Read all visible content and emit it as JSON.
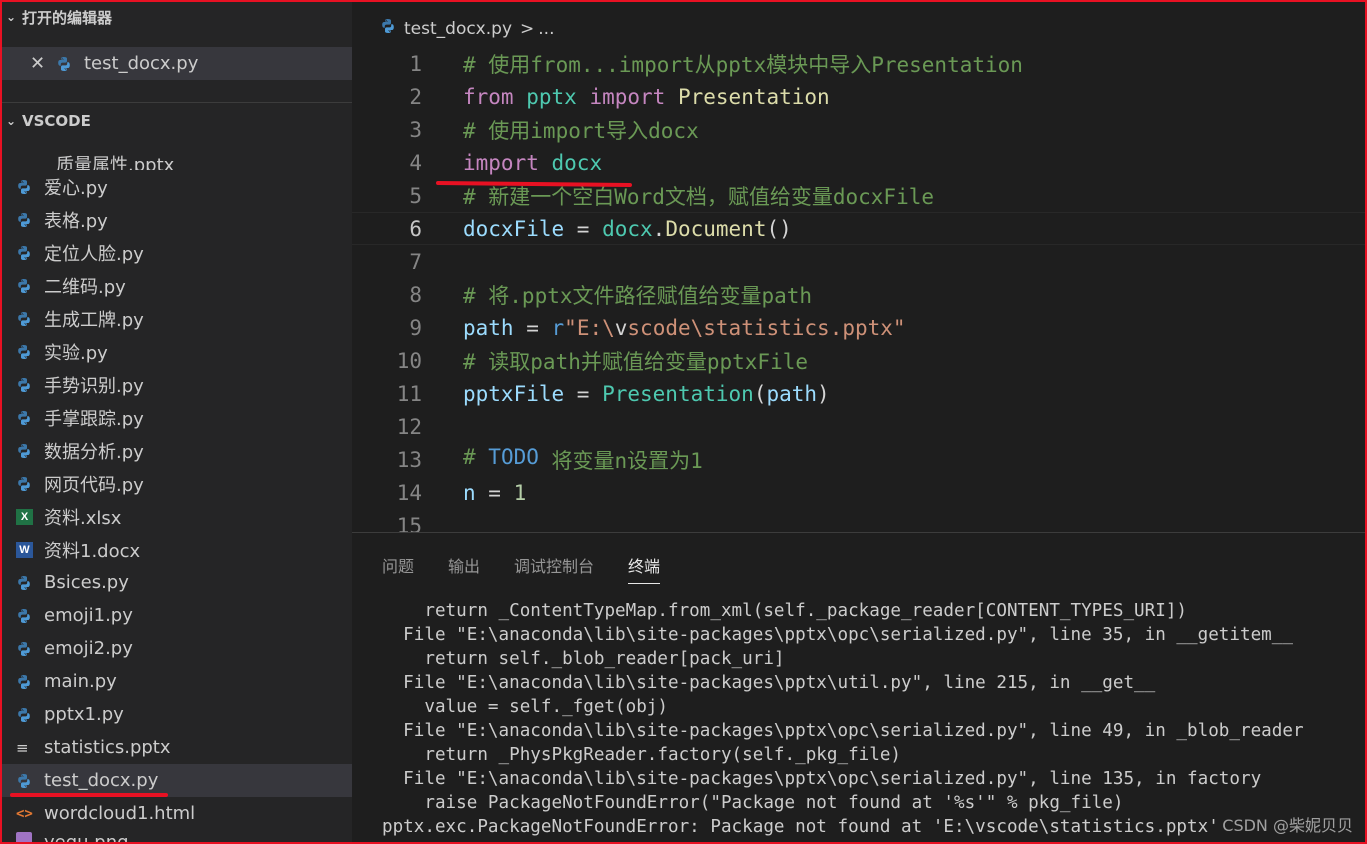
{
  "sidebar": {
    "open_editors_title": "打开的编辑器",
    "open_editors": [
      {
        "label": "test_docx.py"
      }
    ],
    "explorer_title": "VSCODE",
    "files": [
      {
        "label": "质量属性.pptx",
        "icon": "lines-icon"
      },
      {
        "label": "爱心.py",
        "icon": "python-icon"
      },
      {
        "label": "表格.py",
        "icon": "python-icon"
      },
      {
        "label": "定位人脸.py",
        "icon": "python-icon"
      },
      {
        "label": "二维码.py",
        "icon": "python-icon"
      },
      {
        "label": "生成工牌.py",
        "icon": "python-icon"
      },
      {
        "label": "实验.py",
        "icon": "python-icon"
      },
      {
        "label": "手势识别.py",
        "icon": "python-icon"
      },
      {
        "label": "手掌跟踪.py",
        "icon": "python-icon"
      },
      {
        "label": "数据分析.py",
        "icon": "python-icon"
      },
      {
        "label": "网页代码.py",
        "icon": "python-icon"
      },
      {
        "label": "资料.xlsx",
        "icon": "excel-icon"
      },
      {
        "label": "资料1.docx",
        "icon": "word-icon"
      },
      {
        "label": "Bsices.py",
        "icon": "python-icon"
      },
      {
        "label": "emoji1.py",
        "icon": "python-icon"
      },
      {
        "label": "emoji2.py",
        "icon": "python-icon"
      },
      {
        "label": "main.py",
        "icon": "python-icon"
      },
      {
        "label": "pptx1.py",
        "icon": "python-icon"
      },
      {
        "label": "statistics.pptx",
        "icon": "lines-icon"
      },
      {
        "label": "test_docx.py",
        "icon": "python-icon",
        "active": true
      },
      {
        "label": "wordcloud1.html",
        "icon": "html-icon"
      },
      {
        "label": "yegu.png",
        "icon": "image-icon"
      }
    ]
  },
  "editor": {
    "breadcrumb_file": "test_docx.py",
    "breadcrumb_sep": ">",
    "breadcrumb_more": "...",
    "current_line": 6,
    "lines": [
      {
        "n": "1",
        "tokens": [
          {
            "t": "# 使用from...import从pptx模块中导入Presentation",
            "c": "com"
          }
        ]
      },
      {
        "n": "2",
        "tokens": [
          {
            "t": "from",
            "c": "kw"
          },
          {
            "t": " ",
            "c": "op"
          },
          {
            "t": "pptx",
            "c": "mod"
          },
          {
            "t": " ",
            "c": "op"
          },
          {
            "t": "import",
            "c": "kw"
          },
          {
            "t": " ",
            "c": "op"
          },
          {
            "t": "Presentation",
            "c": "fn"
          }
        ]
      },
      {
        "n": "3",
        "tokens": [
          {
            "t": "# 使用import导入docx",
            "c": "com"
          }
        ]
      },
      {
        "n": "4",
        "tokens": [
          {
            "t": "import",
            "c": "kw"
          },
          {
            "t": " ",
            "c": "op"
          },
          {
            "t": "docx",
            "c": "mod"
          }
        ]
      },
      {
        "n": "5",
        "tokens": [
          {
            "t": "# 新建一个空白Word文档，赋值给变量docxFile",
            "c": "com"
          }
        ]
      },
      {
        "n": "6",
        "tokens": [
          {
            "t": "docxFile",
            "c": "var"
          },
          {
            "t": " = ",
            "c": "op"
          },
          {
            "t": "docx",
            "c": "mod"
          },
          {
            "t": ".",
            "c": "op"
          },
          {
            "t": "Document",
            "c": "fn"
          },
          {
            "t": "()",
            "c": "op"
          }
        ]
      },
      {
        "n": "7",
        "tokens": []
      },
      {
        "n": "8",
        "tokens": [
          {
            "t": "# 将.pptx文件路径赋值给变量path",
            "c": "com"
          }
        ]
      },
      {
        "n": "9",
        "tokens": [
          {
            "t": "path",
            "c": "var"
          },
          {
            "t": " = ",
            "c": "op"
          },
          {
            "t": "r",
            "c": "sp"
          },
          {
            "t": "\"E:\\",
            "c": "str"
          },
          {
            "t": "v",
            "c": "op"
          },
          {
            "t": "scode\\statistics.pptx\"",
            "c": "str"
          }
        ]
      },
      {
        "n": "10",
        "tokens": [
          {
            "t": "# 读取path并赋值给变量pptxFile",
            "c": "com"
          }
        ]
      },
      {
        "n": "11",
        "tokens": [
          {
            "t": "pptxFile",
            "c": "var"
          },
          {
            "t": " = ",
            "c": "op"
          },
          {
            "t": "Presentation",
            "c": "cls"
          },
          {
            "t": "(",
            "c": "op"
          },
          {
            "t": "path",
            "c": "var"
          },
          {
            "t": ")",
            "c": "op"
          }
        ]
      },
      {
        "n": "12",
        "tokens": []
      },
      {
        "n": "13",
        "tokens": [
          {
            "t": "# ",
            "c": "com"
          },
          {
            "t": "TODO",
            "c": "todo"
          },
          {
            "t": " 将变量n设置为1",
            "c": "com"
          }
        ]
      },
      {
        "n": "14",
        "tokens": [
          {
            "t": "n",
            "c": "var"
          },
          {
            "t": " = ",
            "c": "op"
          },
          {
            "t": "1",
            "c": "num"
          }
        ]
      },
      {
        "n": "15",
        "tokens": []
      }
    ]
  },
  "panel": {
    "tabs": [
      {
        "label": "问题"
      },
      {
        "label": "输出"
      },
      {
        "label": "调试控制台"
      },
      {
        "label": "终端",
        "active": true
      }
    ],
    "terminal_lines": [
      "    return _ContentTypeMap.from_xml(self._package_reader[CONTENT_TYPES_URI])",
      "  File \"E:\\anaconda\\lib\\site-packages\\pptx\\opc\\serialized.py\", line 35, in __getitem__",
      "    return self._blob_reader[pack_uri]",
      "  File \"E:\\anaconda\\lib\\site-packages\\pptx\\util.py\", line 215, in __get__",
      "    value = self._fget(obj)",
      "  File \"E:\\anaconda\\lib\\site-packages\\pptx\\opc\\serialized.py\", line 49, in _blob_reader",
      "    return _PhysPkgReader.factory(self._pkg_file)",
      "  File \"E:\\anaconda\\lib\\site-packages\\pptx\\opc\\serialized.py\", line 135, in factory",
      "    raise PackageNotFoundError(\"Package not found at '%s'\" % pkg_file)",
      "pptx.exc.PackageNotFoundError: Package not found at 'E:\\vscode\\statistics.pptx'"
    ]
  },
  "watermark": "CSDN @柴妮贝贝",
  "colors": {
    "annotation_red": "#e81123",
    "python_blue": "#3572a5",
    "python_yellow": "#ffd43b"
  }
}
